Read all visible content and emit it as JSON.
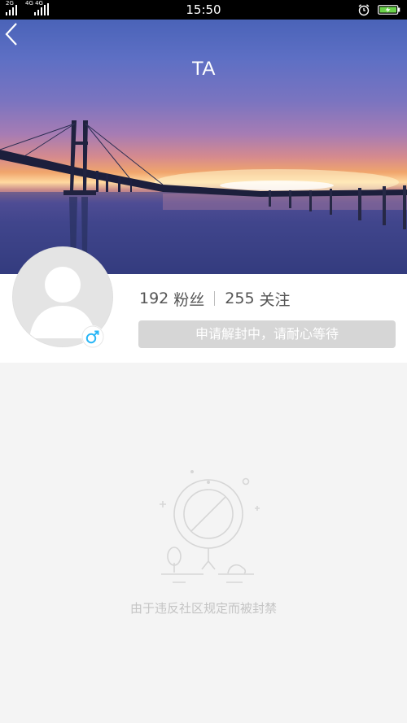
{
  "status_bar": {
    "time": "15:50",
    "network_1": "2G",
    "network_2": "4G 4G",
    "icons": [
      "signal-icon",
      "signal-icon",
      "alarm-icon",
      "battery-charging-icon"
    ]
  },
  "header": {
    "back_icon": "chevron-left-icon",
    "title": "TA"
  },
  "profile": {
    "avatar_icon": "default-avatar-icon",
    "gender_icon": "male-icon",
    "followers_count": "192",
    "followers_label": "粉丝",
    "following_count": "255",
    "following_label": "关注",
    "status_text": "申请解封中，请耐心等待"
  },
  "empty_state": {
    "icon": "banned-sign-icon",
    "message": "由于违反社区规定而被封禁"
  },
  "colors": {
    "accent_male": "#29b6f6",
    "pill_bg": "#d6d6d6",
    "page_bg": "#f4f4f4"
  }
}
